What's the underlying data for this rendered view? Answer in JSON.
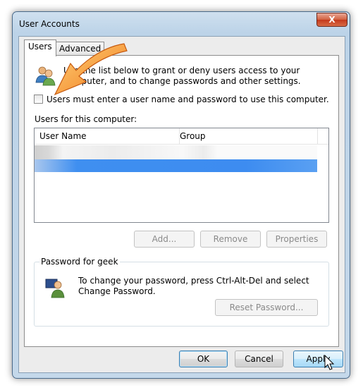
{
  "window": {
    "title": "User Accounts",
    "close_label": "X"
  },
  "tabs": [
    {
      "label": "Users",
      "selected": true
    },
    {
      "label": "Advanced",
      "selected": false
    }
  ],
  "users_tab": {
    "intro": "Use the list below to grant or deny users access to your computer, and to change passwords and other settings.",
    "checkbox_label": "Users must enter a user name and password to use this computer.",
    "checkbox_checked": false,
    "list_label": "Users for this computer:",
    "columns": [
      "User Name",
      "Group"
    ],
    "buttons": {
      "add": "Add...",
      "remove": "Remove",
      "properties": "Properties"
    }
  },
  "password_group": {
    "legend": "Password for geek",
    "text": "To change your password, press Ctrl-Alt-Del and select Change Password.",
    "reset_label": "Reset Password..."
  },
  "dialog_buttons": {
    "ok": "OK",
    "cancel": "Cancel",
    "apply": "Apply"
  },
  "icons": [
    "users-icon",
    "key-user-icon",
    "close-icon",
    "annotation-arrow",
    "mouse-cursor"
  ],
  "colors": {
    "selection": "#3d8cf0",
    "arrow": "#f08a1c",
    "close": "#c4391c"
  }
}
